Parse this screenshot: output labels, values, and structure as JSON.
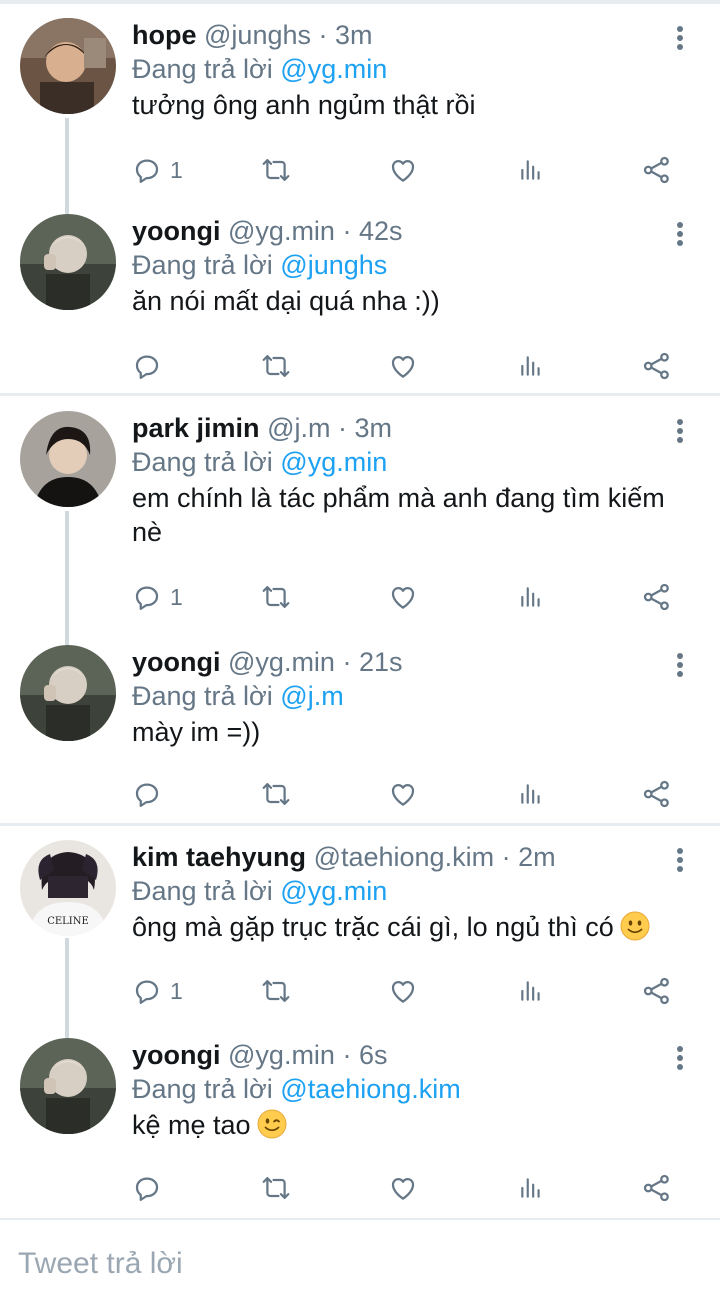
{
  "reply_prefix": "Đang trả lời",
  "threads": [
    {
      "tweets": [
        {
          "name": "hope",
          "handle": "@junghs",
          "time": "3m",
          "reply_to": "@yg.min",
          "text": "tưởng ông anh ngủm thật rồi",
          "reply_count": "1",
          "emoji": ""
        },
        {
          "name": "yoongi",
          "handle": "@yg.min",
          "time": "42s",
          "reply_to": "@junghs",
          "text": "ăn nói mất dại quá nha :))",
          "reply_count": "",
          "emoji": ""
        }
      ]
    },
    {
      "tweets": [
        {
          "name": "park jimin",
          "handle": "@j.m",
          "time": "3m",
          "reply_to": "@yg.min",
          "text": "em chính là tác phẩm mà anh đang tìm kiếm nè",
          "reply_count": "1",
          "emoji": ""
        },
        {
          "name": "yoongi",
          "handle": "@yg.min",
          "time": "21s",
          "reply_to": "@j.m",
          "text": "mày im =))",
          "reply_count": "",
          "emoji": ""
        }
      ]
    },
    {
      "tweets": [
        {
          "name": "kim taehyung",
          "handle": "@taehiong.kim",
          "time": "2m",
          "reply_to": "@yg.min",
          "text": "ông mà gặp trục trặc cái gì, lo ngủ thì có",
          "reply_count": "1",
          "emoji": "slightly-smiling-face-emoji"
        },
        {
          "name": "yoongi",
          "handle": "@yg.min",
          "time": "6s",
          "reply_to": "@taehiong.kim",
          "text": "kệ mẹ tao",
          "reply_count": "",
          "emoji": "winking-face-emoji"
        }
      ]
    }
  ],
  "icons": [
    "reply-icon",
    "retweet-icon",
    "like-icon",
    "analytics-icon",
    "share-icon",
    "more-options-icon"
  ],
  "colors": {
    "link": "#1da1f2",
    "muted": "#657786",
    "text": "#14171a",
    "divider": "#e6ecf0"
  },
  "composer": {
    "placeholder": "Tweet trả lời"
  }
}
